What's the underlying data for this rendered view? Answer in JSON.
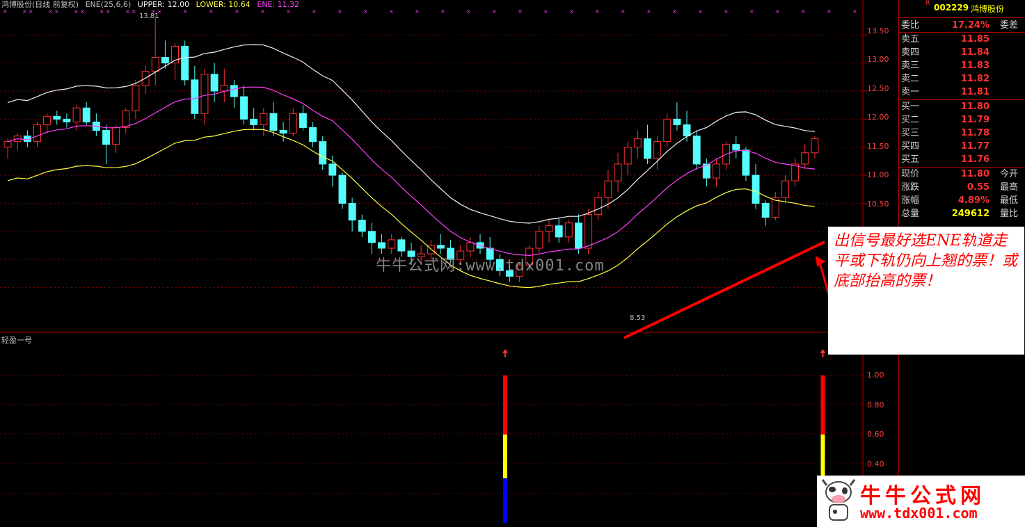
{
  "header": {
    "title": "鸿博股份(日线 前复权)",
    "indicator": "ENE(25,6,6)",
    "upper_label": "UPPER: 12.00",
    "lower_label": "LOWER: 10.64",
    "ene_label": "ENE: 11.32"
  },
  "colors": {
    "up": "#ff3232",
    "down": "#54fcfc",
    "upper": "#f0f0f0",
    "ene": "#ff40ff",
    "lower": "#ffff40",
    "grid": "#800000"
  },
  "price_high_label": "13.81",
  "price_low_label": "8.53",
  "indicator_label": "轻盈一号",
  "y_axis_price": [
    "13.50",
    "13.00",
    "12.50",
    "12.00",
    "11.50",
    "11.00",
    "10.50"
  ],
  "y_axis_indicator": [
    "1.00",
    "0.80",
    "0.60",
    "0.40"
  ],
  "quote": {
    "flag": "R",
    "code": "002229",
    "name": "鸿博股份",
    "ratio_label": "委比",
    "ratio_value": "17.24%",
    "ratio_diff_label": "委差",
    "asks": [
      {
        "label": "卖五",
        "price": "11.85"
      },
      {
        "label": "卖四",
        "price": "11.84"
      },
      {
        "label": "卖三",
        "price": "11.83"
      },
      {
        "label": "卖二",
        "price": "11.82"
      },
      {
        "label": "卖一",
        "price": "11.81"
      }
    ],
    "bids": [
      {
        "label": "买一",
        "price": "11.80"
      },
      {
        "label": "买二",
        "price": "11.79"
      },
      {
        "label": "买三",
        "price": "11.78"
      },
      {
        "label": "买四",
        "price": "11.77"
      },
      {
        "label": "买五",
        "price": "11.76"
      }
    ],
    "stats": [
      {
        "label": "现价",
        "value": "11.80",
        "label2": "今开",
        "color": "#ff3232"
      },
      {
        "label": "涨跌",
        "value": "0.55",
        "label2": "最高",
        "color": "#ff3232"
      },
      {
        "label": "涨幅",
        "value": "4.89%",
        "label2": "最低",
        "color": "#ff3232"
      },
      {
        "label": "总量",
        "value": "249612",
        "label2": "量比",
        "color": "#ffff00"
      }
    ]
  },
  "annotation": "出信号最好选ENE轨道走平或下轨仍向上翘的票！或底部抬高的票！",
  "watermark": "牛牛公式网:www.tdx001.com",
  "logo": {
    "title": "牛牛公式网",
    "url": "www.tdx001.com"
  },
  "chart_data": {
    "type": "candlestick",
    "note": "approximate daily OHLC read from the chart",
    "candles": [
      [
        11.5,
        11.65,
        11.3,
        11.6
      ],
      [
        11.6,
        11.75,
        11.45,
        11.7
      ],
      [
        11.7,
        11.8,
        11.5,
        11.6
      ],
      [
        11.6,
        11.95,
        11.5,
        11.9
      ],
      [
        11.9,
        12.1,
        11.75,
        12.05
      ],
      [
        12.05,
        12.15,
        11.9,
        12.0
      ],
      [
        12.0,
        12.1,
        11.85,
        11.95
      ],
      [
        11.95,
        12.25,
        11.8,
        12.2
      ],
      [
        12.2,
        12.3,
        11.9,
        11.95
      ],
      [
        11.95,
        12.1,
        11.7,
        11.8
      ],
      [
        11.8,
        11.9,
        11.2,
        11.55
      ],
      [
        11.55,
        11.9,
        11.4,
        11.85
      ],
      [
        11.85,
        12.2,
        11.75,
        12.15
      ],
      [
        12.15,
        12.7,
        12.0,
        12.6
      ],
      [
        12.6,
        12.95,
        12.45,
        12.85
      ],
      [
        12.85,
        13.81,
        12.6,
        13.1
      ],
      [
        13.1,
        13.4,
        12.9,
        13.0
      ],
      [
        13.0,
        13.35,
        12.7,
        13.3
      ],
      [
        13.3,
        13.4,
        12.6,
        12.7
      ],
      [
        12.7,
        12.95,
        12.0,
        12.1
      ],
      [
        12.1,
        12.9,
        11.9,
        12.8
      ],
      [
        12.8,
        13.0,
        12.3,
        12.5
      ],
      [
        12.5,
        12.9,
        12.3,
        12.6
      ],
      [
        12.6,
        12.7,
        12.2,
        12.4
      ],
      [
        12.4,
        12.6,
        11.9,
        12.0
      ],
      [
        12.0,
        12.2,
        11.8,
        11.9
      ],
      [
        11.9,
        12.2,
        11.7,
        12.1
      ],
      [
        12.1,
        12.3,
        11.7,
        11.8
      ],
      [
        11.8,
        11.95,
        11.6,
        11.75
      ],
      [
        11.75,
        12.2,
        11.7,
        12.1
      ],
      [
        12.1,
        12.25,
        11.8,
        11.85
      ],
      [
        11.85,
        11.95,
        11.5,
        11.6
      ],
      [
        11.6,
        11.7,
        11.1,
        11.2
      ],
      [
        11.2,
        11.35,
        10.8,
        11.0
      ],
      [
        11.0,
        11.05,
        10.4,
        10.5
      ],
      [
        10.5,
        10.6,
        10.0,
        10.2
      ],
      [
        10.2,
        10.3,
        9.9,
        10.0
      ],
      [
        10.0,
        10.15,
        9.6,
        9.8
      ],
      [
        9.8,
        9.95,
        9.6,
        9.7
      ],
      [
        9.7,
        9.95,
        9.6,
        9.85
      ],
      [
        9.85,
        9.9,
        9.55,
        9.65
      ],
      [
        9.65,
        9.8,
        9.4,
        9.55
      ],
      [
        9.55,
        9.75,
        9.4,
        9.6
      ],
      [
        9.6,
        9.85,
        9.5,
        9.75
      ],
      [
        9.75,
        9.95,
        9.6,
        9.7
      ],
      [
        9.7,
        9.85,
        9.45,
        9.5
      ],
      [
        9.5,
        9.75,
        9.4,
        9.65
      ],
      [
        9.65,
        9.9,
        9.55,
        9.8
      ],
      [
        9.8,
        9.95,
        9.6,
        9.7
      ],
      [
        9.7,
        9.9,
        9.4,
        9.5
      ],
      [
        9.5,
        9.6,
        9.2,
        9.3
      ],
      [
        9.3,
        9.4,
        9.1,
        9.2
      ],
      [
        9.2,
        9.45,
        9.1,
        9.4
      ],
      [
        9.4,
        9.75,
        9.3,
        9.7
      ],
      [
        9.7,
        10.1,
        9.6,
        10.0
      ],
      [
        10.0,
        10.2,
        9.8,
        10.1
      ],
      [
        10.1,
        10.25,
        9.8,
        9.9
      ],
      [
        9.9,
        10.2,
        9.8,
        10.15
      ],
      [
        10.15,
        10.3,
        9.6,
        9.7
      ],
      [
        9.7,
        10.4,
        9.6,
        10.3
      ],
      [
        10.3,
        10.7,
        10.2,
        10.6
      ],
      [
        10.6,
        11.1,
        10.4,
        10.9
      ],
      [
        10.9,
        11.4,
        10.7,
        11.2
      ],
      [
        11.2,
        11.6,
        11.0,
        11.5
      ],
      [
        11.5,
        11.8,
        11.3,
        11.65
      ],
      [
        11.65,
        11.9,
        11.2,
        11.3
      ],
      [
        11.3,
        11.7,
        11.1,
        11.6
      ],
      [
        11.6,
        12.1,
        11.5,
        12.0
      ],
      [
        12.0,
        12.3,
        11.8,
        11.9
      ],
      [
        11.9,
        12.15,
        11.6,
        11.7
      ],
      [
        11.7,
        11.8,
        11.1,
        11.2
      ],
      [
        11.2,
        11.3,
        10.8,
        10.95
      ],
      [
        10.95,
        11.3,
        10.8,
        11.2
      ],
      [
        11.2,
        11.6,
        11.1,
        11.55
      ],
      [
        11.55,
        11.7,
        11.3,
        11.45
      ],
      [
        11.45,
        11.5,
        10.9,
        11.0
      ],
      [
        11.0,
        11.2,
        10.4,
        10.5
      ],
      [
        10.5,
        10.55,
        10.1,
        10.25
      ],
      [
        10.25,
        10.7,
        10.2,
        10.6
      ],
      [
        10.6,
        11.0,
        10.5,
        10.9
      ],
      [
        10.9,
        11.3,
        10.8,
        11.2
      ],
      [
        11.2,
        11.55,
        11.1,
        11.4
      ],
      [
        11.4,
        11.7,
        11.3,
        11.65
      ]
    ],
    "signal_positions": [
      0.585,
      0.955
    ],
    "upper_range": [
      11.2,
      13.1
    ],
    "ylim": [
      8.3,
      13.9
    ]
  }
}
